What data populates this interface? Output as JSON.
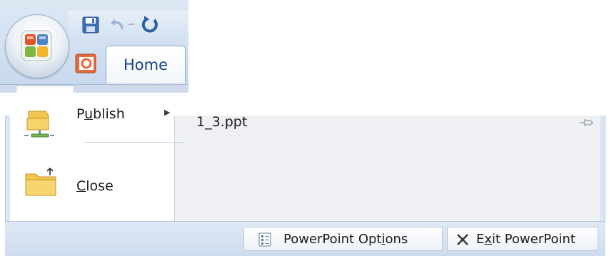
{
  "ribbon": {
    "tab_home": "Home"
  },
  "office_menu": {
    "items": [
      {
        "label_prefix": "P",
        "label_accel": "u",
        "label_suffix": "blish",
        "has_submenu": true
      },
      {
        "label_prefix": "",
        "label_accel": "C",
        "label_suffix": "lose",
        "has_submenu": false
      }
    ],
    "recent_documents": [
      {
        "name": "1_3.ppt"
      }
    ],
    "footer": {
      "options_prefix": "PowerPoint Opt",
      "options_accel": "i",
      "options_suffix": "ons",
      "exit_prefix": "E",
      "exit_accel": "x",
      "exit_suffix": "it PowerPoint"
    }
  },
  "colors": {
    "ribbon_bg": "#d3e1f1",
    "menu_frame": "#dae6f4",
    "text_blue": "#15428b"
  }
}
